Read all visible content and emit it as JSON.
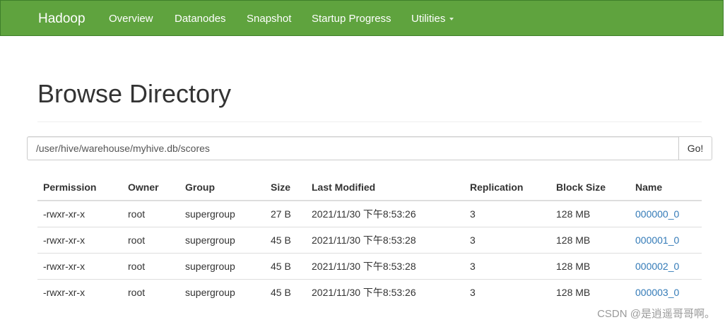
{
  "navbar": {
    "brand": "Hadoop",
    "items": [
      {
        "label": "Overview"
      },
      {
        "label": "Datanodes"
      },
      {
        "label": "Snapshot"
      },
      {
        "label": "Startup Progress"
      },
      {
        "label": "Utilities"
      }
    ]
  },
  "page": {
    "title": "Browse Directory"
  },
  "path_bar": {
    "value": "/user/hive/warehouse/myhive.db/scores",
    "go_label": "Go!"
  },
  "table": {
    "headers": [
      "Permission",
      "Owner",
      "Group",
      "Size",
      "Last Modified",
      "Replication",
      "Block Size",
      "Name"
    ],
    "rows": [
      {
        "permission": "-rwxr-xr-x",
        "owner": "root",
        "group": "supergroup",
        "size": "27 B",
        "modified": "2021/11/30 下午8:53:26",
        "replication": "3",
        "block_size": "128 MB",
        "name": "000000_0"
      },
      {
        "permission": "-rwxr-xr-x",
        "owner": "root",
        "group": "supergroup",
        "size": "45 B",
        "modified": "2021/11/30 下午8:53:28",
        "replication": "3",
        "block_size": "128 MB",
        "name": "000001_0"
      },
      {
        "permission": "-rwxr-xr-x",
        "owner": "root",
        "group": "supergroup",
        "size": "45 B",
        "modified": "2021/11/30 下午8:53:28",
        "replication": "3",
        "block_size": "128 MB",
        "name": "000002_0"
      },
      {
        "permission": "-rwxr-xr-x",
        "owner": "root",
        "group": "supergroup",
        "size": "45 B",
        "modified": "2021/11/30 下午8:53:26",
        "replication": "3",
        "block_size": "128 MB",
        "name": "000003_0"
      }
    ]
  },
  "watermark": "CSDN @是逍遥哥哥啊。",
  "colors": {
    "navbar_bg": "#5fa33e",
    "link": "#337ab7"
  }
}
